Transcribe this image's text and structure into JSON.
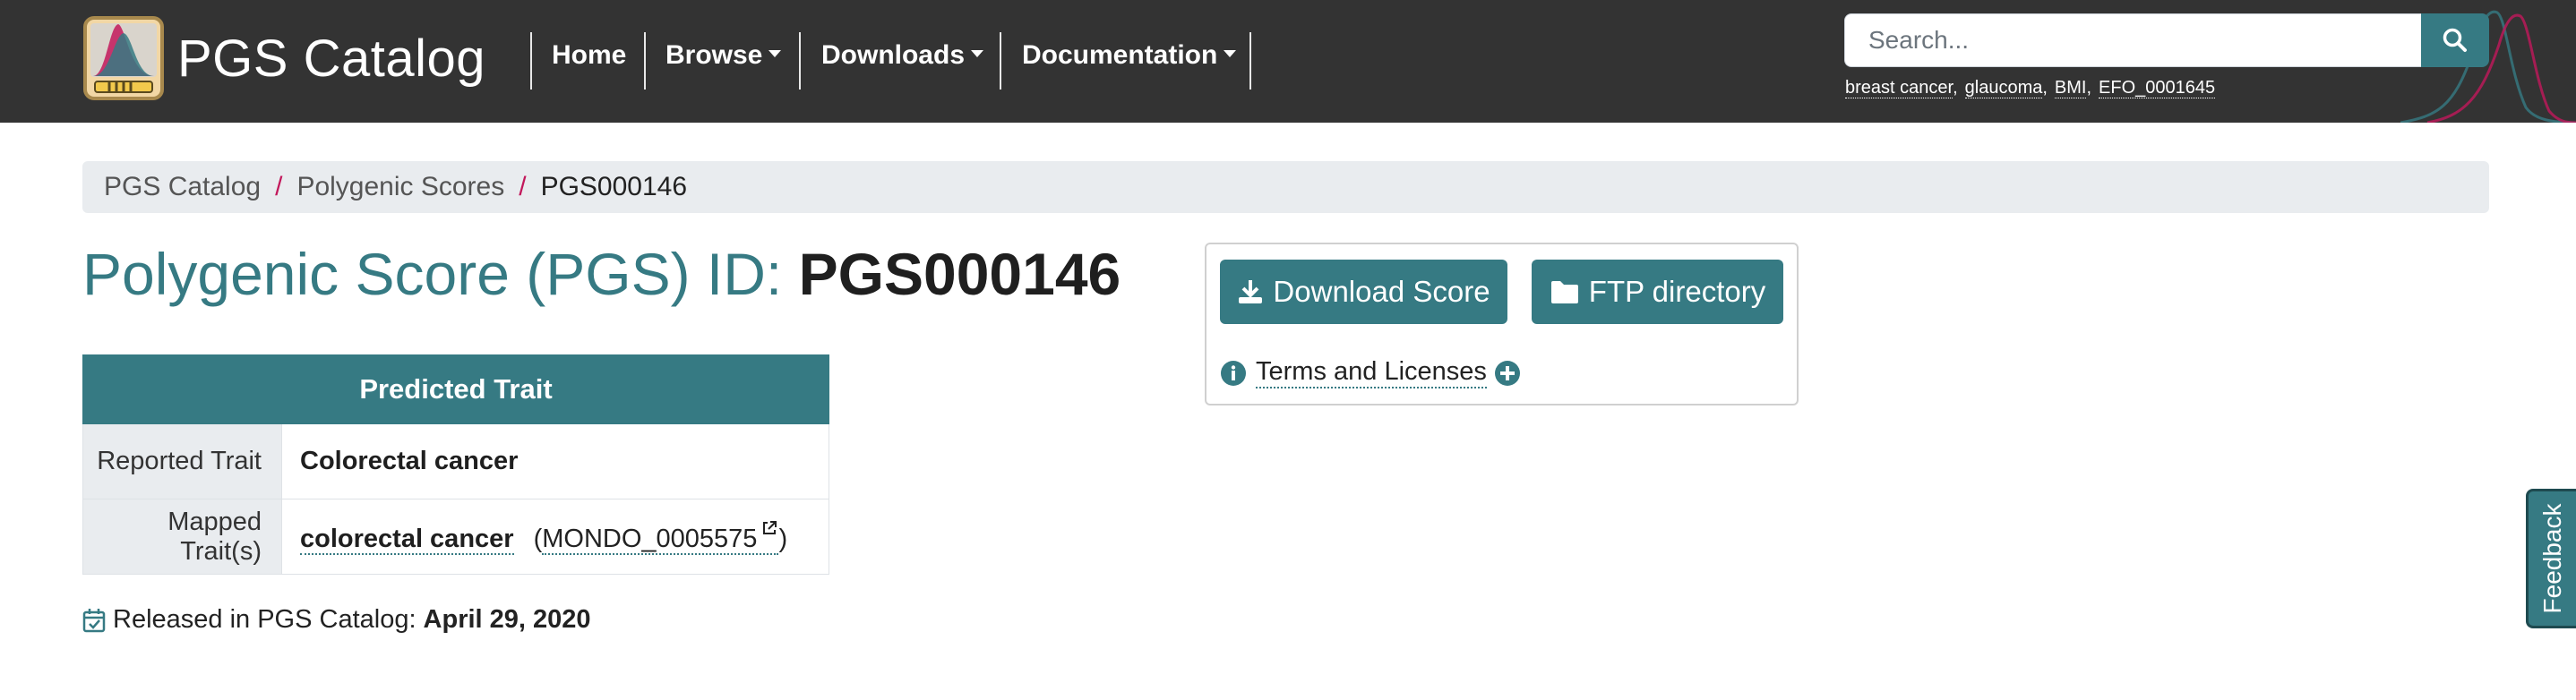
{
  "navbar": {
    "brand": "PGS Catalog",
    "items": [
      {
        "label": "Home"
      },
      {
        "label": "Browse"
      },
      {
        "label": "Downloads"
      },
      {
        "label": "Documentation"
      }
    ],
    "search": {
      "placeholder": "Search...",
      "examples": [
        "breast cancer",
        "glaucoma",
        "BMI",
        "EFO_0001645"
      ]
    }
  },
  "breadcrumb": {
    "items": [
      "PGS Catalog",
      "Polygenic Scores"
    ],
    "current": "PGS000146"
  },
  "page": {
    "title_prefix": "Polygenic Score (PGS) ID: ",
    "pgs_id": "PGS000146"
  },
  "trait_table": {
    "header": "Predicted Trait",
    "reported_label": "Reported Trait",
    "reported_value": "Colorectal cancer",
    "mapped_label": "Mapped Trait(s)",
    "mapped_value": "colorectal cancer",
    "mapped_ontology_id": "MONDO_0005575",
    "paren_open": "(",
    "paren_close": ")"
  },
  "release": {
    "label": "Released in PGS Catalog:",
    "date": "April 29, 2020"
  },
  "downloads": {
    "download_score": "Download Score",
    "ftp_directory": "FTP directory",
    "terms": "Terms and Licenses"
  },
  "feedback": {
    "label": "Feedback"
  },
  "colors": {
    "navbar": "#333333",
    "accent": "#367a83",
    "breadcrumb_bg": "#e9ecef",
    "breadcrumb_sep": "#c2185b"
  },
  "icons": [
    "pgs-logo-icon",
    "search-icon",
    "caret-down-icon",
    "download-icon",
    "folder-icon",
    "info-icon",
    "plus-icon",
    "external-link-icon",
    "calendar-check-icon"
  ]
}
